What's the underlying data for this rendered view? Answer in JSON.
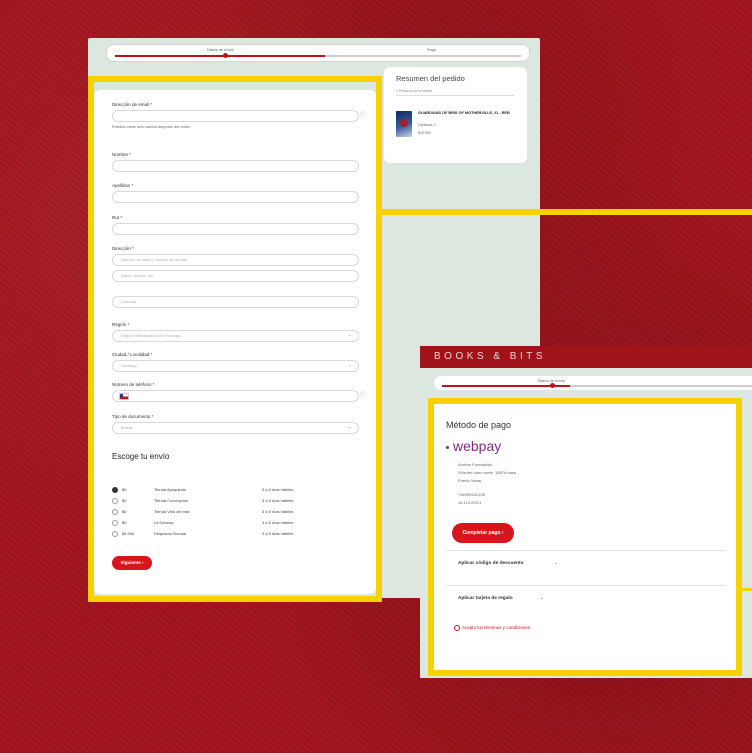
{
  "stepper1": {
    "step1": "Datos de envío",
    "step2": "Pago"
  },
  "form": {
    "email_label": "Dirección de email *",
    "email_help": "Puedes crear una cuenta después del cobro",
    "nombre_label": "Nombre *",
    "apellidos_label": "Apellidos *",
    "rut_label": "Rut *",
    "direccion_label": "Dirección *",
    "direccion_ph1": "Número de casa y nombre de la calle",
    "direccion_ph2": "Depto, oficina, etc.",
    "direccion_ph3": "Comuna",
    "region_label": "Región *",
    "region_value": "Región Metropolitana de Santiago",
    "ciudad_label": "Ciudad / Localidad *",
    "ciudad_value": "Santiago",
    "telefono_label": "Número de teléfono *",
    "documento_label": "Tipo de documento *",
    "documento_value": "Boleta",
    "envio_title": "Escoge tu envío",
    "shipping": [
      {
        "price": "$0",
        "name": "Tienda Apoquindo",
        "time": "3 a 5 días hábiles"
      },
      {
        "price": "$0",
        "name": "Tienda Concepción",
        "time": "3 a 5 días hábiles"
      },
      {
        "price": "$0",
        "name": "Tienda Viña del mar",
        "time": "3 a 5 días hábiles"
      },
      {
        "price": "$0",
        "name": "La Dehesa",
        "time": "3 a 5 días hábiles"
      },
      {
        "price": "$4.990",
        "name": "Despacho Normal",
        "time": "3 a 5 días hábiles"
      }
    ],
    "next_button": "Siguiente ›"
  },
  "summary": {
    "title": "Resumen del pedido",
    "select_label": "1 Producto en el carrito",
    "book_title": "GUARDIANS OF BRIS OF MOTHERVILLE, #1 - REB",
    "quantity": "Cantidad: 1",
    "price": "$15.990"
  },
  "payment": {
    "brand": "BOOKS & BITS",
    "step_label": "Datos de envío",
    "title": "Método de pago",
    "webpay": "webpay",
    "lines": [
      "Andrea Fuenzalida",
      "Viña del carro norte, 1587A casa",
      "Puerto Varas",
      "+56995432198",
      "16.110.203-1"
    ],
    "complete_button": "Completar pago ›",
    "discount_label": "Aplicar código de descuento",
    "giftcard_label": "Aplicar tarjeta de regalo",
    "terms_label": "Acepto los términos y condiciones"
  }
}
